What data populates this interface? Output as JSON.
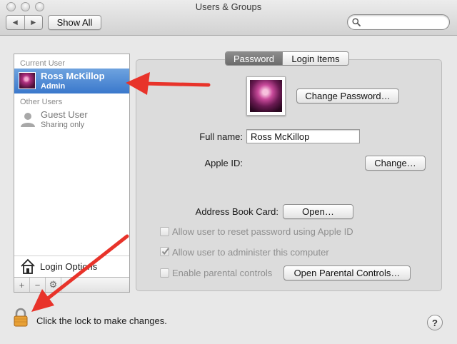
{
  "window": {
    "title": "Users & Groups"
  },
  "toolbar": {
    "show_all": "Show All",
    "search_value": ""
  },
  "sidebar": {
    "current_user_header": "Current User",
    "current_user": {
      "name": "Ross McKillop",
      "role": "Admin"
    },
    "other_users_header": "Other Users",
    "guest": {
      "name": "Guest User",
      "role": "Sharing only"
    },
    "login_options": "Login Options",
    "buttons": [
      "+",
      "−",
      "⚙"
    ]
  },
  "tabs": {
    "password": "Password",
    "login_items": "Login Items"
  },
  "main": {
    "change_password": "Change Password…",
    "full_name_label": "Full name:",
    "full_name_value": "Ross McKillop",
    "apple_id_label": "Apple ID:",
    "apple_id_change": "Change…",
    "address_book_label": "Address Book Card:",
    "open_button": "Open…",
    "options": [
      {
        "label": "Allow user to reset password using Apple ID",
        "checked": false
      },
      {
        "label": "Allow user to administer this computer",
        "checked": true
      },
      {
        "label": "Enable parental controls",
        "checked": false
      }
    ],
    "open_parental_controls": "Open Parental Controls…"
  },
  "footer": {
    "lock_text": "Click the lock to make changes.",
    "help": "?"
  },
  "colors": {
    "selection": "#3a78cc",
    "arrow": "#e8332a",
    "lock_body": "#e8a136"
  }
}
